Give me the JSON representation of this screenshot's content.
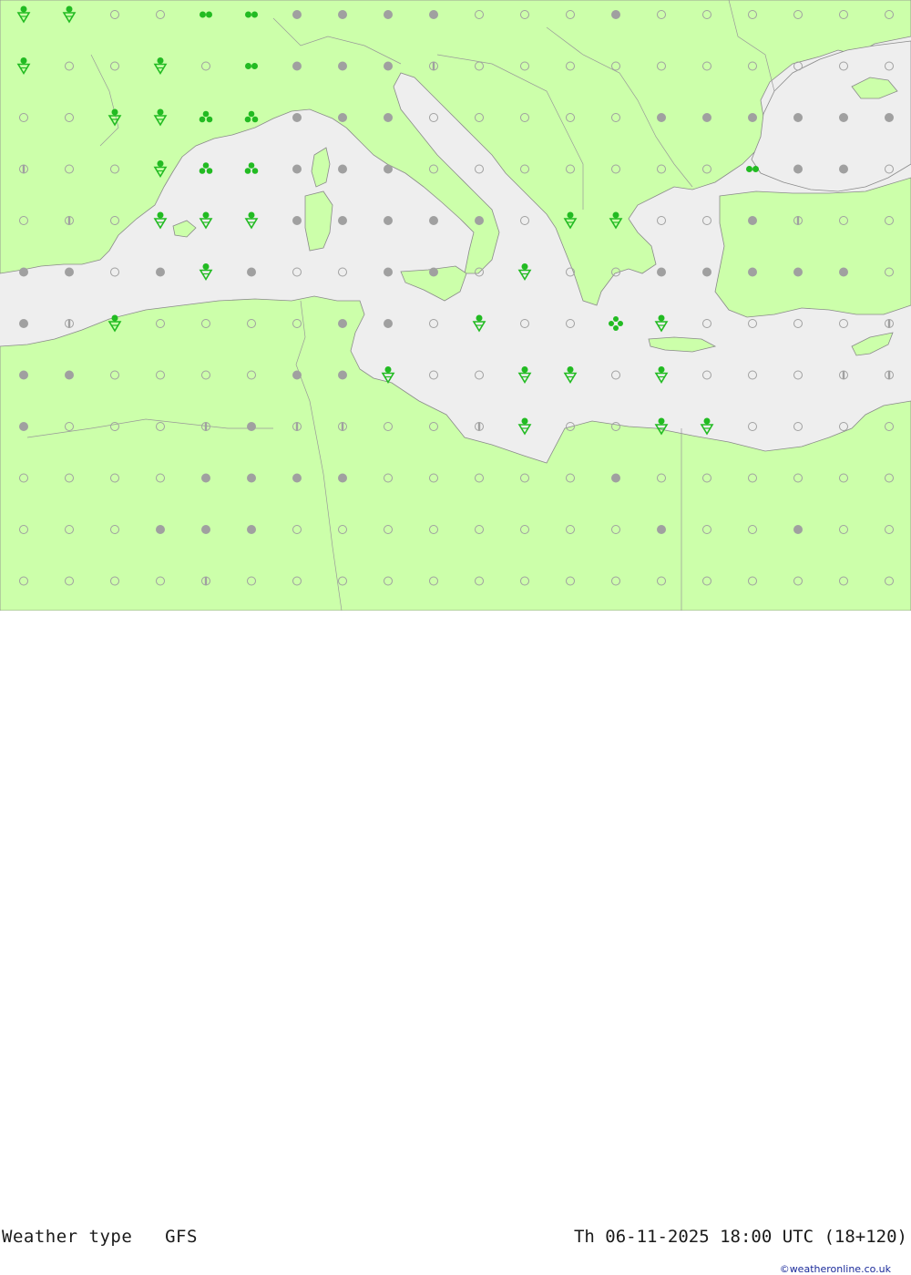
{
  "title": "Weather type   GFS",
  "datetime": "Th 06-11-2025 18:00 UTC (18+120)",
  "credit": "©weatheronline.co.uk",
  "colors": {
    "land": "#ccff aa",
    "sea": "#eeeeee",
    "border": "#999999",
    "rain": "#22bb22",
    "overcast": "#a0a0a0",
    "clear": "#a8a8a8"
  },
  "legend_symbols": [
    "clear-circle",
    "overcast-dot",
    "half-cloud",
    "rain-shower",
    "showers-dots",
    "thunder-cluster"
  ],
  "symbols": [
    [
      "shower",
      "shower",
      "clear",
      "clear",
      "rain2",
      "rain2",
      "dot",
      "dot",
      "dot",
      "dot",
      "clear",
      "clear",
      "clear",
      "dot",
      "clear",
      "clear",
      "clear",
      "clear",
      "clear",
      "clear"
    ],
    [
      "shower",
      "clear",
      "clear",
      "shower",
      "clear",
      "rain2",
      "dot",
      "dot",
      "dot",
      "half",
      "clear",
      "clear",
      "clear",
      "clear",
      "clear",
      "clear",
      "clear",
      "clear",
      "clear",
      "clear"
    ],
    [
      "clear",
      "clear",
      "shower",
      "shower",
      "rain3",
      "rain3",
      "dot",
      "dot",
      "dot",
      "clear",
      "clear",
      "clear",
      "clear",
      "clear",
      "dot",
      "dot",
      "dot",
      "dot",
      "dot",
      "dot"
    ],
    [
      "half",
      "clear",
      "clear",
      "shower",
      "rain3",
      "rain3",
      "dot",
      "dot",
      "dot",
      "clear",
      "clear",
      "clear",
      "clear",
      "clear",
      "clear",
      "clear",
      "rain2",
      "dot",
      "dot",
      "clear"
    ],
    [
      "clear",
      "half",
      "clear",
      "shower",
      "shower",
      "shower",
      "dot",
      "dot",
      "dot",
      "dot",
      "dot",
      "clear",
      "shower",
      "shower",
      "clear",
      "clear",
      "dot",
      "half",
      "clear",
      "clear"
    ],
    [
      "dot",
      "dot",
      "clear",
      "dot",
      "shower",
      "dot",
      "clear",
      "clear",
      "dot",
      "dot",
      "clear",
      "shower",
      "clear",
      "clear",
      "dot",
      "dot",
      "dot",
      "dot",
      "dot",
      "clear"
    ],
    [
      "dot",
      "half",
      "shower",
      "clear",
      "clear",
      "clear",
      "clear",
      "dot",
      "dot",
      "clear",
      "shower",
      "clear",
      "clear",
      "rain4",
      "shower",
      "clear",
      "clear",
      "clear",
      "clear",
      "half"
    ],
    [
      "dot",
      "dot",
      "clear",
      "clear",
      "clear",
      "clear",
      "dot",
      "dot",
      "shower",
      "clear",
      "clear",
      "shower",
      "shower",
      "clear",
      "shower",
      "clear",
      "clear",
      "clear",
      "half",
      "half"
    ],
    [
      "dot",
      "clear",
      "clear",
      "clear",
      "half",
      "dot",
      "half",
      "half",
      "clear",
      "clear",
      "half",
      "shower",
      "clear",
      "clear",
      "shower",
      "shower",
      "clear",
      "clear",
      "clear",
      "clear"
    ],
    [
      "clear",
      "clear",
      "clear",
      "clear",
      "dot",
      "dot",
      "dot",
      "dot",
      "clear",
      "clear",
      "clear",
      "clear",
      "clear",
      "dot",
      "clear",
      "clear",
      "clear",
      "clear",
      "clear",
      "clear"
    ],
    [
      "clear",
      "clear",
      "clear",
      "dot",
      "dot",
      "dot",
      "clear",
      "clear",
      "clear",
      "clear",
      "clear",
      "clear",
      "clear",
      "clear",
      "dot",
      "clear",
      "clear",
      "dot",
      "clear",
      "clear"
    ],
    [
      "clear",
      "clear",
      "clear",
      "clear",
      "half",
      "clear",
      "clear",
      "clear",
      "clear",
      "clear",
      "clear",
      "clear",
      "clear",
      "clear",
      "clear",
      "clear",
      "clear",
      "clear",
      "clear",
      "clear"
    ]
  ]
}
